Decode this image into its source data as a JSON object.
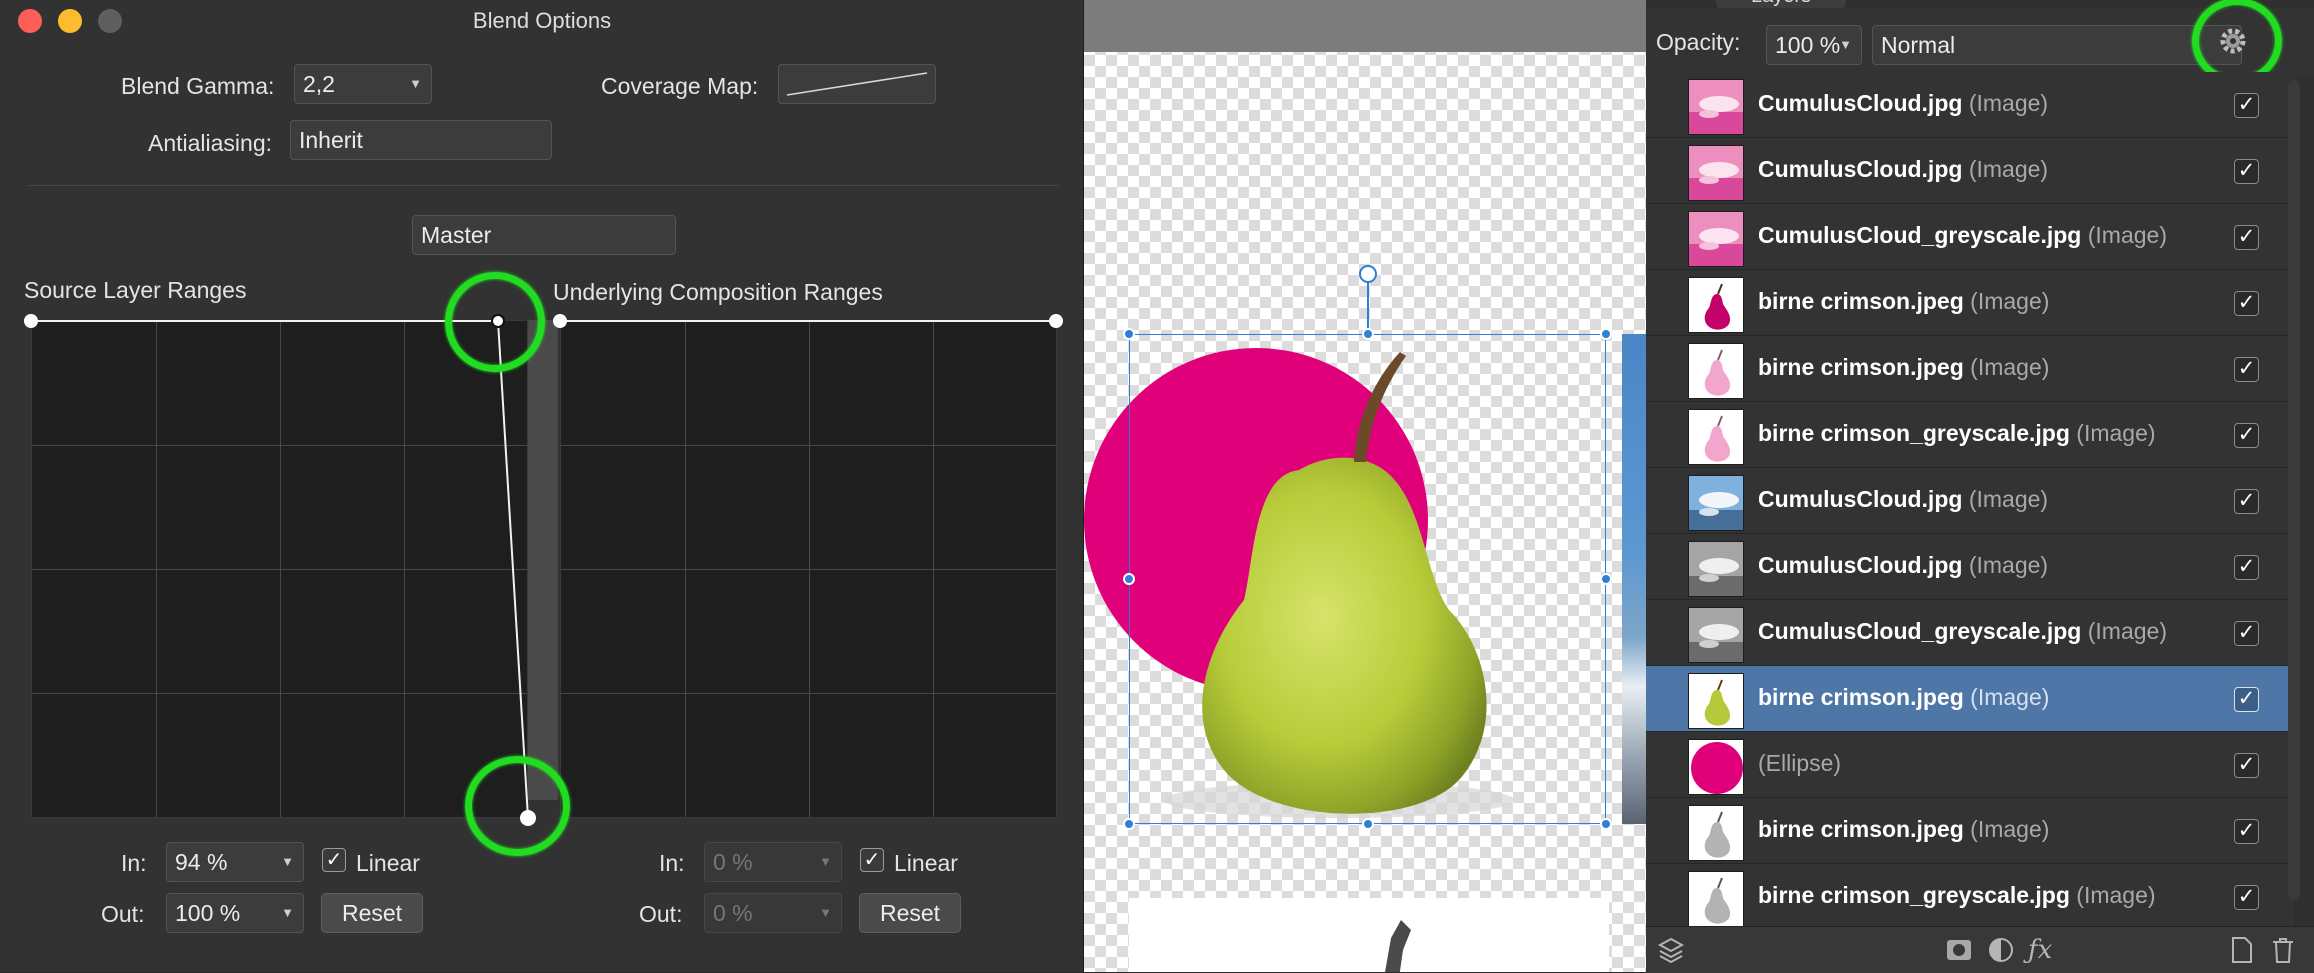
{
  "blend_options": {
    "title": "Blend Options",
    "blend_gamma_label": "Blend Gamma:",
    "blend_gamma_value": "2,2",
    "coverage_map_label": "Coverage Map:",
    "antialiasing_label": "Antialiasing:",
    "antialiasing_value": "Inherit",
    "channel_value": "Master",
    "source_ranges_label": "Source Layer Ranges",
    "underlying_ranges_label": "Underlying Composition Ranges",
    "source": {
      "in_label": "In:",
      "in_value": "94 %",
      "out_label": "Out:",
      "out_value": "100 %",
      "linear_label": "Linear",
      "reset_label": "Reset"
    },
    "underlying": {
      "in_label": "In:",
      "in_value": "0 %",
      "out_label": "Out:",
      "out_value": "0 %",
      "linear_label": "Linear",
      "reset_label": "Reset"
    }
  },
  "layers_panel": {
    "tab_label": "Layers",
    "opacity_label": "Opacity:",
    "opacity_value": "100 %",
    "blend_mode_value": "Normal",
    "rows": [
      {
        "name": "CumulusCloud.jpg",
        "type": "(Image)",
        "thumb": "pink-cloud",
        "checked": true
      },
      {
        "name": "CumulusCloud.jpg",
        "type": "(Image)",
        "thumb": "pink-cloud",
        "checked": true
      },
      {
        "name": "CumulusCloud_greyscale.jpg",
        "type": "(Image)",
        "thumb": "pink-cloud",
        "checked": true
      },
      {
        "name": "birne crimson.jpeg",
        "type": "(Image)",
        "thumb": "magenta-pear",
        "checked": true
      },
      {
        "name": "birne crimson.jpeg",
        "type": "(Image)",
        "thumb": "pink-pear",
        "checked": true
      },
      {
        "name": "birne crimson_greyscale.jpg",
        "type": "(Image)",
        "thumb": "pink-pear",
        "checked": true
      },
      {
        "name": "CumulusCloud.jpg",
        "type": "(Image)",
        "thumb": "blue-cloud",
        "checked": true
      },
      {
        "name": "CumulusCloud.jpg",
        "type": "(Image)",
        "thumb": "grey-cloud",
        "checked": true
      },
      {
        "name": "CumulusCloud_greyscale.jpg",
        "type": "(Image)",
        "thumb": "grey-cloud",
        "checked": true
      },
      {
        "name": "birne crimson.jpeg",
        "type": "(Image)",
        "thumb": "green-pear",
        "checked": true,
        "selected": true
      },
      {
        "name": "",
        "type": "(Ellipse)",
        "thumb": "magenta-ellipse",
        "checked": true
      },
      {
        "name": "birne crimson.jpeg",
        "type": "(Image)",
        "thumb": "grey-pear",
        "checked": true
      },
      {
        "name": "birne crimson_greyscale.jpg",
        "type": "(Image)",
        "thumb": "grey-pear",
        "checked": true
      }
    ]
  },
  "colors": {
    "ellipse": "#e0007a",
    "pear": "#b8cc3a",
    "selection": "#4e76a6",
    "highlight": "#22dc22"
  }
}
